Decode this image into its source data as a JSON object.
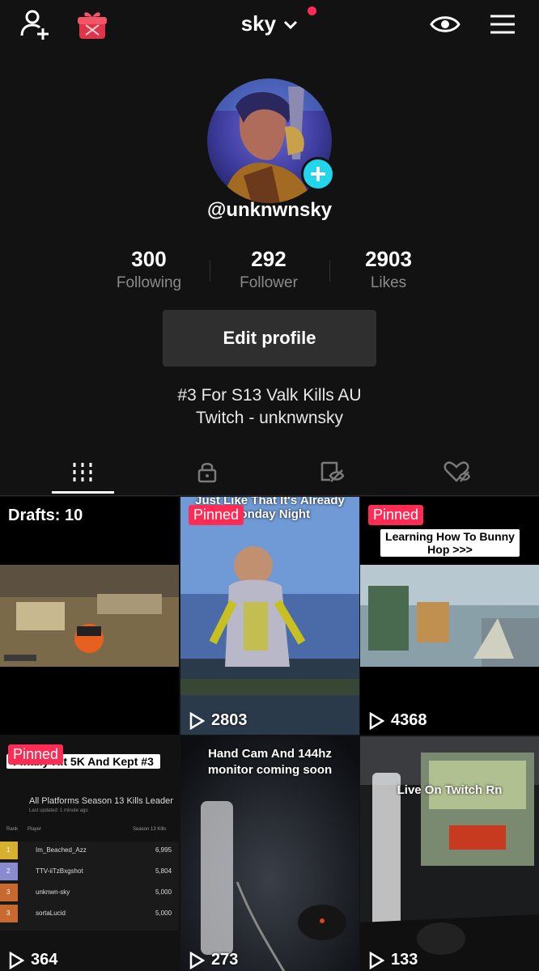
{
  "header": {
    "username": "sky",
    "icons": [
      "add-user-icon",
      "gift-icon",
      "eye-icon",
      "menu-icon"
    ]
  },
  "profile": {
    "handle": "@unknwnsky",
    "stats": [
      {
        "value": "300",
        "label": "Following"
      },
      {
        "value": "292",
        "label": "Follower"
      },
      {
        "value": "2903",
        "label": "Likes"
      }
    ],
    "edit_label": "Edit profile",
    "bio_line1": "#3 For S13 Valk Kills AU",
    "bio_line2": "Twitch - unknwnsky"
  },
  "tabs": [
    "videos-grid-icon",
    "private-lock-icon",
    "hidden-tag-icon",
    "liked-heart-icon"
  ],
  "grid": {
    "drafts_label": "Drafts: 10",
    "pinned_label": "Pinned",
    "videos": [
      {
        "views": "2803",
        "overlay": "Just Like That It's Already Monday Night"
      },
      {
        "views": "4368",
        "overlay": "Learning How To Bunny Hop >>>"
      },
      {
        "views": "364",
        "overlay": "Finally Hit 5K And Kept #3"
      },
      {
        "views": "273",
        "overlay": "Hand Cam And 144hz monitor coming soon"
      },
      {
        "views": "133",
        "overlay": "Live On Twitch Rn"
      }
    ],
    "leaderboard": {
      "title": "All Platforms Season 13 Kills Leader",
      "updated": "Last updated: 1 minute ago",
      "col_rank": "Rank",
      "col_player": "Player",
      "col_kills": "Season 13 Kills",
      "rows": [
        {
          "rank": "1",
          "player": "Im_Beached_Azz",
          "kills": "6,995"
        },
        {
          "rank": "2",
          "player": "TTV-iiTzBxgshot",
          "kills": "5,804"
        },
        {
          "rank": "3",
          "player": "unknwn-sky",
          "kills": "5,000"
        },
        {
          "rank": "3",
          "player": "sortaLucid",
          "kills": "5,000"
        }
      ]
    }
  },
  "colors": {
    "background": "#121212",
    "accent": "#fe2c55",
    "add_badge": "#20d5ec"
  }
}
